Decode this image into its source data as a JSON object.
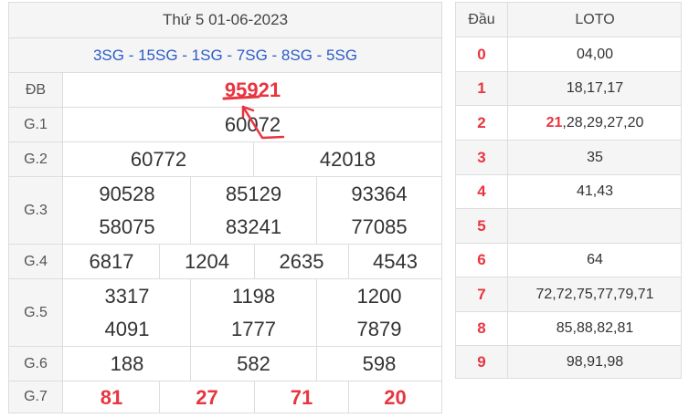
{
  "results": {
    "date": "Thứ 5 01-06-2023",
    "codes": "3SG - 15SG - 1SG - 7SG - 8SG - 5SG",
    "prizes": [
      {
        "label": "ĐB",
        "numbers": [
          "95921"
        ]
      },
      {
        "label": "G.1",
        "numbers": [
          "60072"
        ]
      },
      {
        "label": "G.2",
        "numbers": [
          "60772",
          "42018"
        ]
      },
      {
        "label": "G.3",
        "numbers": [
          "90528",
          "85129",
          "93364",
          "58075",
          "83241",
          "77085"
        ]
      },
      {
        "label": "G.4",
        "numbers": [
          "6817",
          "1204",
          "2635",
          "4543"
        ]
      },
      {
        "label": "G.5",
        "numbers": [
          "3317",
          "1198",
          "1200",
          "4091",
          "1777",
          "7879"
        ]
      },
      {
        "label": "G.6",
        "numbers": [
          "188",
          "582",
          "598"
        ]
      },
      {
        "label": "G.7",
        "numbers": [
          "81",
          "27",
          "71",
          "20"
        ]
      }
    ]
  },
  "loto": {
    "headers": [
      "Đầu",
      "LOTO"
    ],
    "rows": [
      {
        "head": "0",
        "highlight": "",
        "values": "04,00"
      },
      {
        "head": "1",
        "highlight": "",
        "values": "18,17,17"
      },
      {
        "head": "2",
        "highlight": "21",
        "values": ",28,29,27,20"
      },
      {
        "head": "3",
        "highlight": "",
        "values": "35"
      },
      {
        "head": "4",
        "highlight": "",
        "values": "41,43"
      },
      {
        "head": "5",
        "highlight": "",
        "values": ""
      },
      {
        "head": "6",
        "highlight": "",
        "values": "64"
      },
      {
        "head": "7",
        "highlight": "",
        "values": "72,72,75,77,79,71"
      },
      {
        "head": "8",
        "highlight": "",
        "values": "85,88,82,81"
      },
      {
        "head": "9",
        "highlight": "",
        "values": "98,91,98"
      }
    ]
  },
  "colors": {
    "accent_red": "#e8353f",
    "code_blue": "#2a5cc6",
    "border": "#dddddd",
    "header_bg": "#f5f5f5"
  },
  "annotation": {
    "icon": "red-arrow-annotation-icon"
  }
}
